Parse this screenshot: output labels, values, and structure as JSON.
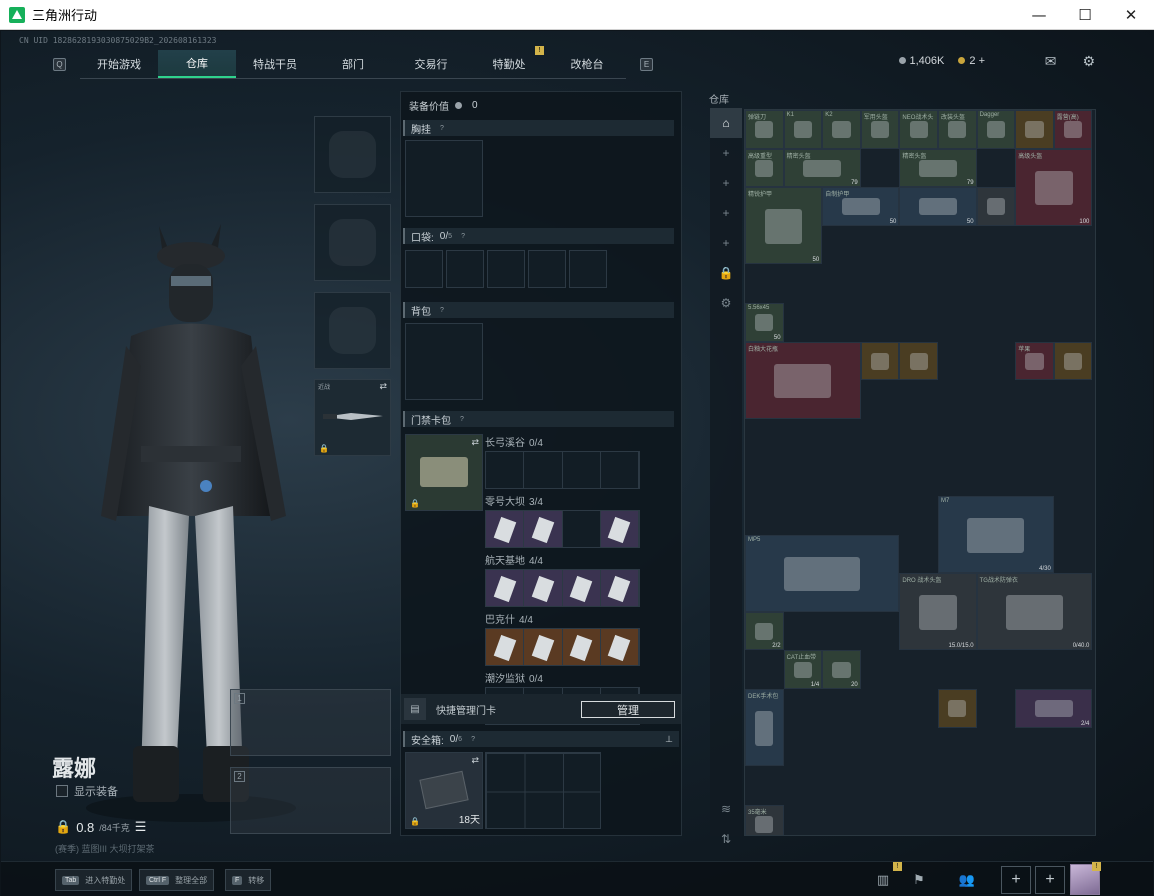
{
  "window": {
    "title": "三角洲行动",
    "minimize": "—",
    "maximize": "☐",
    "close": "✕"
  },
  "uid": "CN UID 1828628193030875029B2_202608161323",
  "nav": {
    "left_key": "Q",
    "right_key": "E",
    "tabs": [
      {
        "label": "开始游戏",
        "active": false
      },
      {
        "label": "仓库",
        "active": true
      },
      {
        "label": "特战干员",
        "active": false
      },
      {
        "label": "部门",
        "active": false
      },
      {
        "label": "交易行",
        "active": false
      },
      {
        "label": "特勤处",
        "active": false,
        "badge": "!"
      },
      {
        "label": "改枪台",
        "active": false
      }
    ]
  },
  "currency": {
    "coins": "1,406K",
    "tickets": "2",
    "plus": "+"
  },
  "character": {
    "name": "露娜",
    "show_equipment": "显示装备",
    "weight": "0.8",
    "weight_max": "/84千克",
    "season": "(赛季)  蓝图III  大坝打架茶"
  },
  "middle": {
    "equipment_value_label": "装备价值",
    "equipment_value": "0",
    "chest_rig": "胸挂",
    "pockets": "口袋:",
    "pockets_value": "0/",
    "pockets_cap": "5",
    "backpack": "背包",
    "keycard_bag": "门禁卡包",
    "key_groups": [
      {
        "name": "长弓溪谷",
        "count": "0/4"
      },
      {
        "name": "零号大坝",
        "count": "3/4"
      },
      {
        "name": "航天基地",
        "count": "4/4"
      },
      {
        "name": "巴克什",
        "count": "4/4"
      },
      {
        "name": "潮汐监狱",
        "count": "0/4"
      }
    ],
    "quick_manage": "快捷管理门卡",
    "manage_button": "管理",
    "safe_box": "安全箱:",
    "safe_box_value": "0/",
    "safe_box_cap": "6",
    "safe_box_time": "18天"
  },
  "melee": {
    "label": "近战",
    "swap": "⇄"
  },
  "warehouse": {
    "title": "仓库",
    "items": [
      {
        "label": "弹链刀",
        "color": "green",
        "count": ""
      },
      {
        "label": "K1",
        "color": "green",
        "count": ""
      },
      {
        "label": "K2",
        "color": "green",
        "count": ""
      },
      {
        "label": "军用头盔",
        "color": "green",
        "count": ""
      },
      {
        "label": "NEO战术头",
        "color": "green",
        "count": ""
      },
      {
        "label": "改装头盔",
        "color": "green",
        "count": ""
      },
      {
        "label": "Dagger",
        "color": "green",
        "count": ""
      },
      {
        "label": "",
        "color": "gold",
        "count": ""
      },
      {
        "label": "露营(高)",
        "color": "red",
        "count": ""
      },
      {
        "label": "高级重型",
        "color": "green",
        "count": ""
      },
      {
        "label": "精密头盔",
        "color": "green",
        "count": "79"
      },
      {
        "label": "精密头盔",
        "color": "green",
        "count": "79"
      },
      {
        "label": "高级头盔",
        "color": "red",
        "count": "100"
      },
      {
        "label": "精锐护甲",
        "color": "green",
        "count": "50"
      },
      {
        "label": "自制护甲",
        "color": "blue",
        "count": "50"
      },
      {
        "label": "",
        "color": "blue",
        "count": "50"
      },
      {
        "label": "",
        "color": "gray",
        "count": ""
      },
      {
        "label": "5.56x45",
        "color": "green",
        "count": "50"
      },
      {
        "label": "白釉大花瓶",
        "color": "red",
        "count": ""
      },
      {
        "label": "",
        "color": "gold",
        "count": ""
      },
      {
        "label": "",
        "color": "gold",
        "count": ""
      },
      {
        "label": "苹果",
        "color": "red",
        "count": ""
      },
      {
        "label": "",
        "color": "gold",
        "count": ""
      },
      {
        "label": "M7",
        "color": "blue",
        "count": "4/30"
      },
      {
        "label": "MP5",
        "color": "blue",
        "count": ""
      },
      {
        "label": "DRO 战术头盔",
        "color": "gray",
        "count": "15.0/15.0"
      },
      {
        "label": "TG战术防弹衣",
        "color": "gray",
        "count": "0/40.0"
      },
      {
        "label": "",
        "color": "green",
        "count": "2/2"
      },
      {
        "label": "CAT止血带",
        "color": "green",
        "count": "1/4"
      },
      {
        "label": "",
        "color": "green",
        "count": "20"
      },
      {
        "label": "DEK手术包",
        "color": "blue",
        "count": ""
      },
      {
        "label": "",
        "color": "gold",
        "count": ""
      },
      {
        "label": "",
        "color": "purple",
        "count": "2/4"
      },
      {
        "label": "35毫米",
        "color": "gray",
        "count": ""
      }
    ]
  },
  "bottom": {
    "hotkeys": [
      {
        "key": "Tab",
        "label": "进入特勤处"
      },
      {
        "key": "Ctrl F",
        "label": "整理全部"
      },
      {
        "key": "F",
        "label": "转移"
      }
    ],
    "badge": "!"
  }
}
